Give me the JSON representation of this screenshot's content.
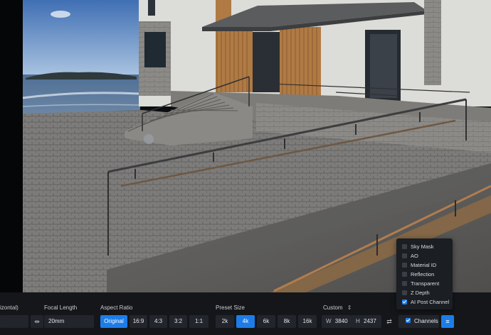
{
  "camera": {
    "fov_label": "izontal)",
    "focal_length_label": "Focal Length",
    "focal_length_value": "20mm",
    "focal_icon": "width-arrows-icon"
  },
  "aspect": {
    "label": "Aspect Ratio",
    "options": [
      "Original",
      "16:9",
      "4:3",
      "3:2",
      "1:1"
    ],
    "selected": "Original"
  },
  "preset": {
    "label": "Preset Size",
    "options": [
      "2k",
      "4k",
      "6k",
      "8k",
      "16k"
    ],
    "selected": "4k"
  },
  "custom": {
    "label": "Custom",
    "w_label": "W",
    "w_value": "3840",
    "h_label": "H",
    "h_value": "2437",
    "swap_icon": "swap-icon",
    "sort_icon": "sort-icon"
  },
  "channels": {
    "button_label": "Channels",
    "items": [
      {
        "label": "Sky Mask",
        "checked": false
      },
      {
        "label": "AO",
        "checked": false
      },
      {
        "label": "Material ID",
        "checked": false
      },
      {
        "label": "Reflection",
        "checked": false
      },
      {
        "label": "Transparent",
        "checked": false
      },
      {
        "label": "Z Depth",
        "checked": false
      },
      {
        "label": "AI Post Channel",
        "checked": true
      }
    ],
    "settings_icon": "sliders-icon"
  },
  "colors": {
    "accent": "#1c7de8",
    "bar_bg": "#14161a",
    "field_bg": "#22252b"
  }
}
